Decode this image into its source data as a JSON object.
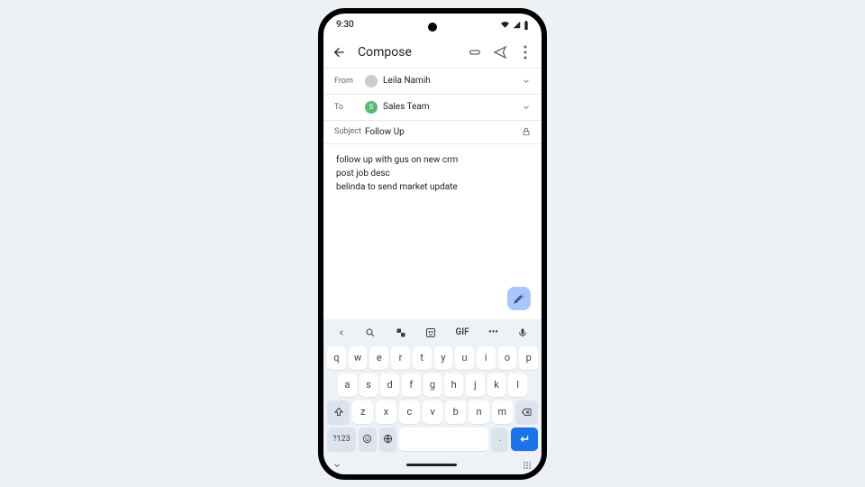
{
  "status": {
    "time": "9:30"
  },
  "appbar": {
    "title": "Compose"
  },
  "from": {
    "label": "From",
    "name": "Leila Namih"
  },
  "to": {
    "label": "To",
    "name": "Sales Team",
    "initial": "S"
  },
  "subject": {
    "label": "Subject",
    "value": "Follow Up"
  },
  "body": {
    "line1": "follow up with gus on new crm",
    "line2": "post job desc",
    "line3": "belinda to send market update"
  },
  "kb": {
    "gif": "GIF",
    "row1": [
      "q",
      "w",
      "e",
      "r",
      "t",
      "y",
      "u",
      "i",
      "o",
      "p"
    ],
    "row2": [
      "a",
      "s",
      "d",
      "f",
      "g",
      "h",
      "j",
      "k",
      "l"
    ],
    "row3": [
      "z",
      "x",
      "c",
      "v",
      "b",
      "n",
      "m"
    ],
    "sym": "?123",
    "comma": ",",
    "period": "."
  }
}
